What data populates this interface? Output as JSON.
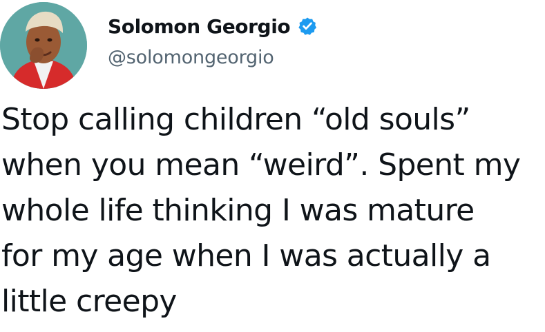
{
  "author": {
    "display_name": "Solomon Georgio",
    "handle": "@solomongeorgio",
    "verified_icon": "verified-badge-icon",
    "verified_color": "#1d9bf0"
  },
  "tweet": {
    "lines": [
      "Stop calling children “old souls”",
      "when you mean “weird”. Spent my",
      "whole life thinking I was mature",
      "for my age when I was actually a",
      "little creepy"
    ]
  }
}
